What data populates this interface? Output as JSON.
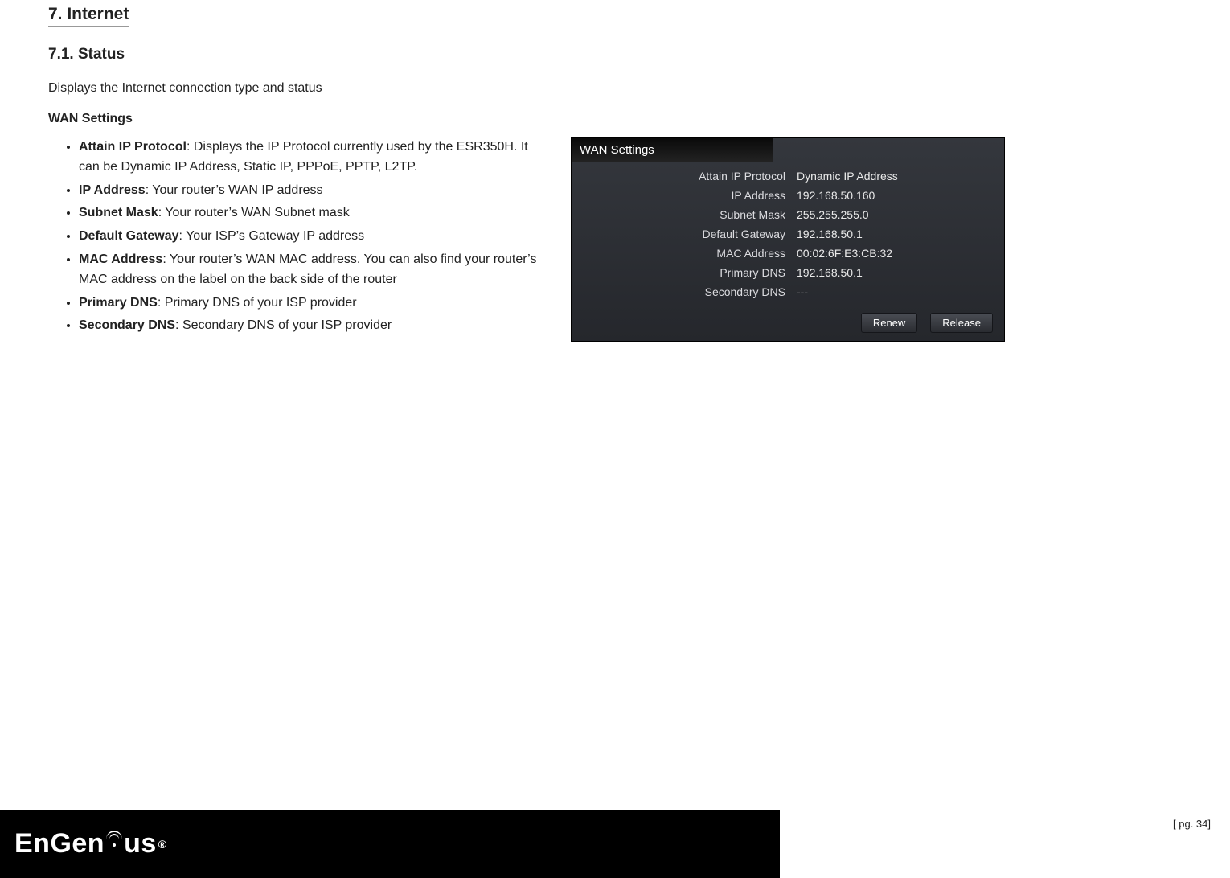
{
  "headings": {
    "section": "7.  Internet",
    "subsection": "7.1.  Status",
    "intro": "Displays the Internet connection type and status",
    "block_title": "WAN Settings"
  },
  "definitions": [
    {
      "term": "Attain IP Protocol",
      "desc": ": Displays the IP Protocol currently used by the ESR350H. It can be Dynamic IP Address, Static IP, PPPoE, PPTP, L2TP."
    },
    {
      "term": "IP Address",
      "desc": ": Your router’s WAN IP address"
    },
    {
      "term": "Subnet Mask",
      "desc": ": Your router’s WAN Subnet mask"
    },
    {
      "term": "Default Gateway",
      "desc": ": Your ISP’s Gateway IP address"
    },
    {
      "term": "MAC Address",
      "desc": ": Your router’s WAN MAC address. You can also find your router’s MAC address on the label on the back side of the router"
    },
    {
      "term": "Primary DNS",
      "desc": ": Primary DNS of your ISP provider"
    },
    {
      "term": "Secondary DNS",
      "desc": ": Secondary DNS of your ISP provider"
    }
  ],
  "wan_panel": {
    "title": "WAN Settings",
    "rows": [
      {
        "label": "Attain IP Protocol",
        "value": "Dynamic IP Address"
      },
      {
        "label": "IP Address",
        "value": "192.168.50.160"
      },
      {
        "label": "Subnet Mask",
        "value": "255.255.255.0"
      },
      {
        "label": "Default Gateway",
        "value": "192.168.50.1"
      },
      {
        "label": "MAC Address",
        "value": "00:02:6F:E3:CB:32"
      },
      {
        "label": "Primary DNS",
        "value": "192.168.50.1"
      },
      {
        "label": "Secondary DNS",
        "value": "---"
      }
    ],
    "buttons": {
      "renew": "Renew",
      "release": "Release"
    }
  },
  "footer": {
    "logo_text_1": "EnGen",
    "logo_text_2": "us",
    "reg": "®",
    "page_label": "[ pg. 34]"
  }
}
